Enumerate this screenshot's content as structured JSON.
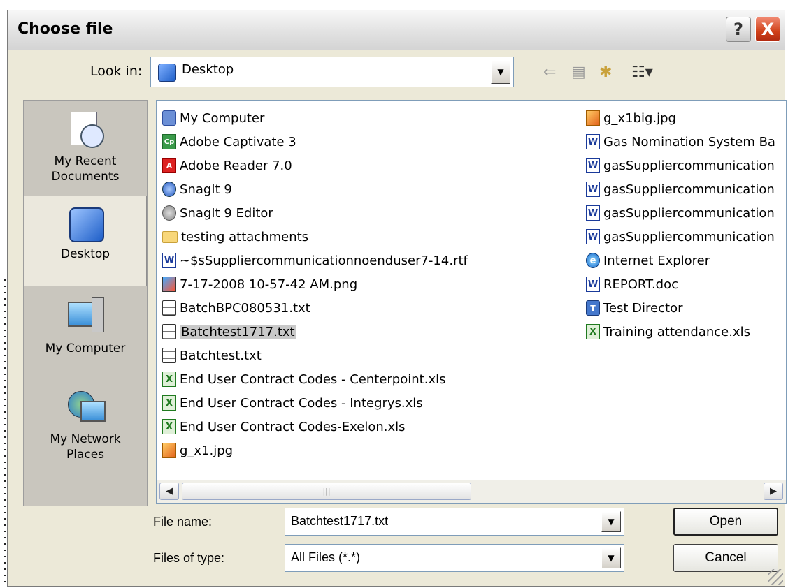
{
  "window": {
    "title": "Choose file"
  },
  "lookin": {
    "label": "Look in:",
    "value": "Desktop"
  },
  "places": [
    {
      "line1": "My Recent",
      "line2": "Documents",
      "icon": "recent-documents-icon",
      "selected": false
    },
    {
      "line1": "Desktop",
      "line2": "",
      "icon": "desktop-icon",
      "selected": true
    },
    {
      "line1": "My Computer",
      "line2": "",
      "icon": "my-computer-icon",
      "selected": false
    },
    {
      "line1": "My Network",
      "line2": "Places",
      "icon": "network-places-icon",
      "selected": false
    }
  ],
  "files_left": [
    {
      "name": "My Computer",
      "icon": "comp"
    },
    {
      "name": "Adobe Captivate 3",
      "icon": "cp"
    },
    {
      "name": "Adobe Reader 7.0",
      "icon": "pdf"
    },
    {
      "name": "SnagIt 9",
      "icon": "snag"
    },
    {
      "name": "SnagIt 9 Editor",
      "icon": "snag2"
    },
    {
      "name": "testing attachments",
      "icon": "folder"
    },
    {
      "name": "~$sSuppliercommunicationnoenduser7-14.rtf",
      "icon": "word"
    },
    {
      "name": "7-17-2008 10-57-42 AM.png",
      "icon": "png"
    },
    {
      "name": "BatchBPC080531.txt",
      "icon": "txt"
    },
    {
      "name": "Batchtest1717.txt",
      "icon": "txt",
      "selected": true
    },
    {
      "name": "Batchtest.txt",
      "icon": "txt"
    },
    {
      "name": "End User Contract Codes - Centerpoint.xls",
      "icon": "xls"
    },
    {
      "name": "End User Contract Codes - Integrys.xls",
      "icon": "xls"
    },
    {
      "name": "End User Contract Codes-Exelon.xls",
      "icon": "xls"
    },
    {
      "name": "g_x1.jpg",
      "icon": "img"
    }
  ],
  "files_right": [
    {
      "name": "g_x1big.jpg",
      "icon": "img"
    },
    {
      "name": "Gas Nomination System Ba",
      "icon": "word"
    },
    {
      "name": "gasSuppliercommunication",
      "icon": "word"
    },
    {
      "name": "gasSuppliercommunication",
      "icon": "word"
    },
    {
      "name": "gasSuppliercommunication",
      "icon": "word"
    },
    {
      "name": "gasSuppliercommunication",
      "icon": "word"
    },
    {
      "name": "Internet Explorer",
      "icon": "ie"
    },
    {
      "name": "REPORT.doc",
      "icon": "word"
    },
    {
      "name": "Test Director",
      "icon": "td"
    },
    {
      "name": "Training attendance.xls",
      "icon": "xls"
    }
  ],
  "filename": {
    "label": "File name:",
    "value": "Batchtest1717.txt"
  },
  "filetype": {
    "label": "Files of type:",
    "value": "All Files (*.*)"
  },
  "buttons": {
    "open": "Open",
    "cancel": "Cancel",
    "help": "?",
    "close": "X"
  },
  "icon_glyphs": {
    "word": "W",
    "xls": "X",
    "cp": "Cp",
    "pdf": "A",
    "ie": "e",
    "td": "T"
  }
}
